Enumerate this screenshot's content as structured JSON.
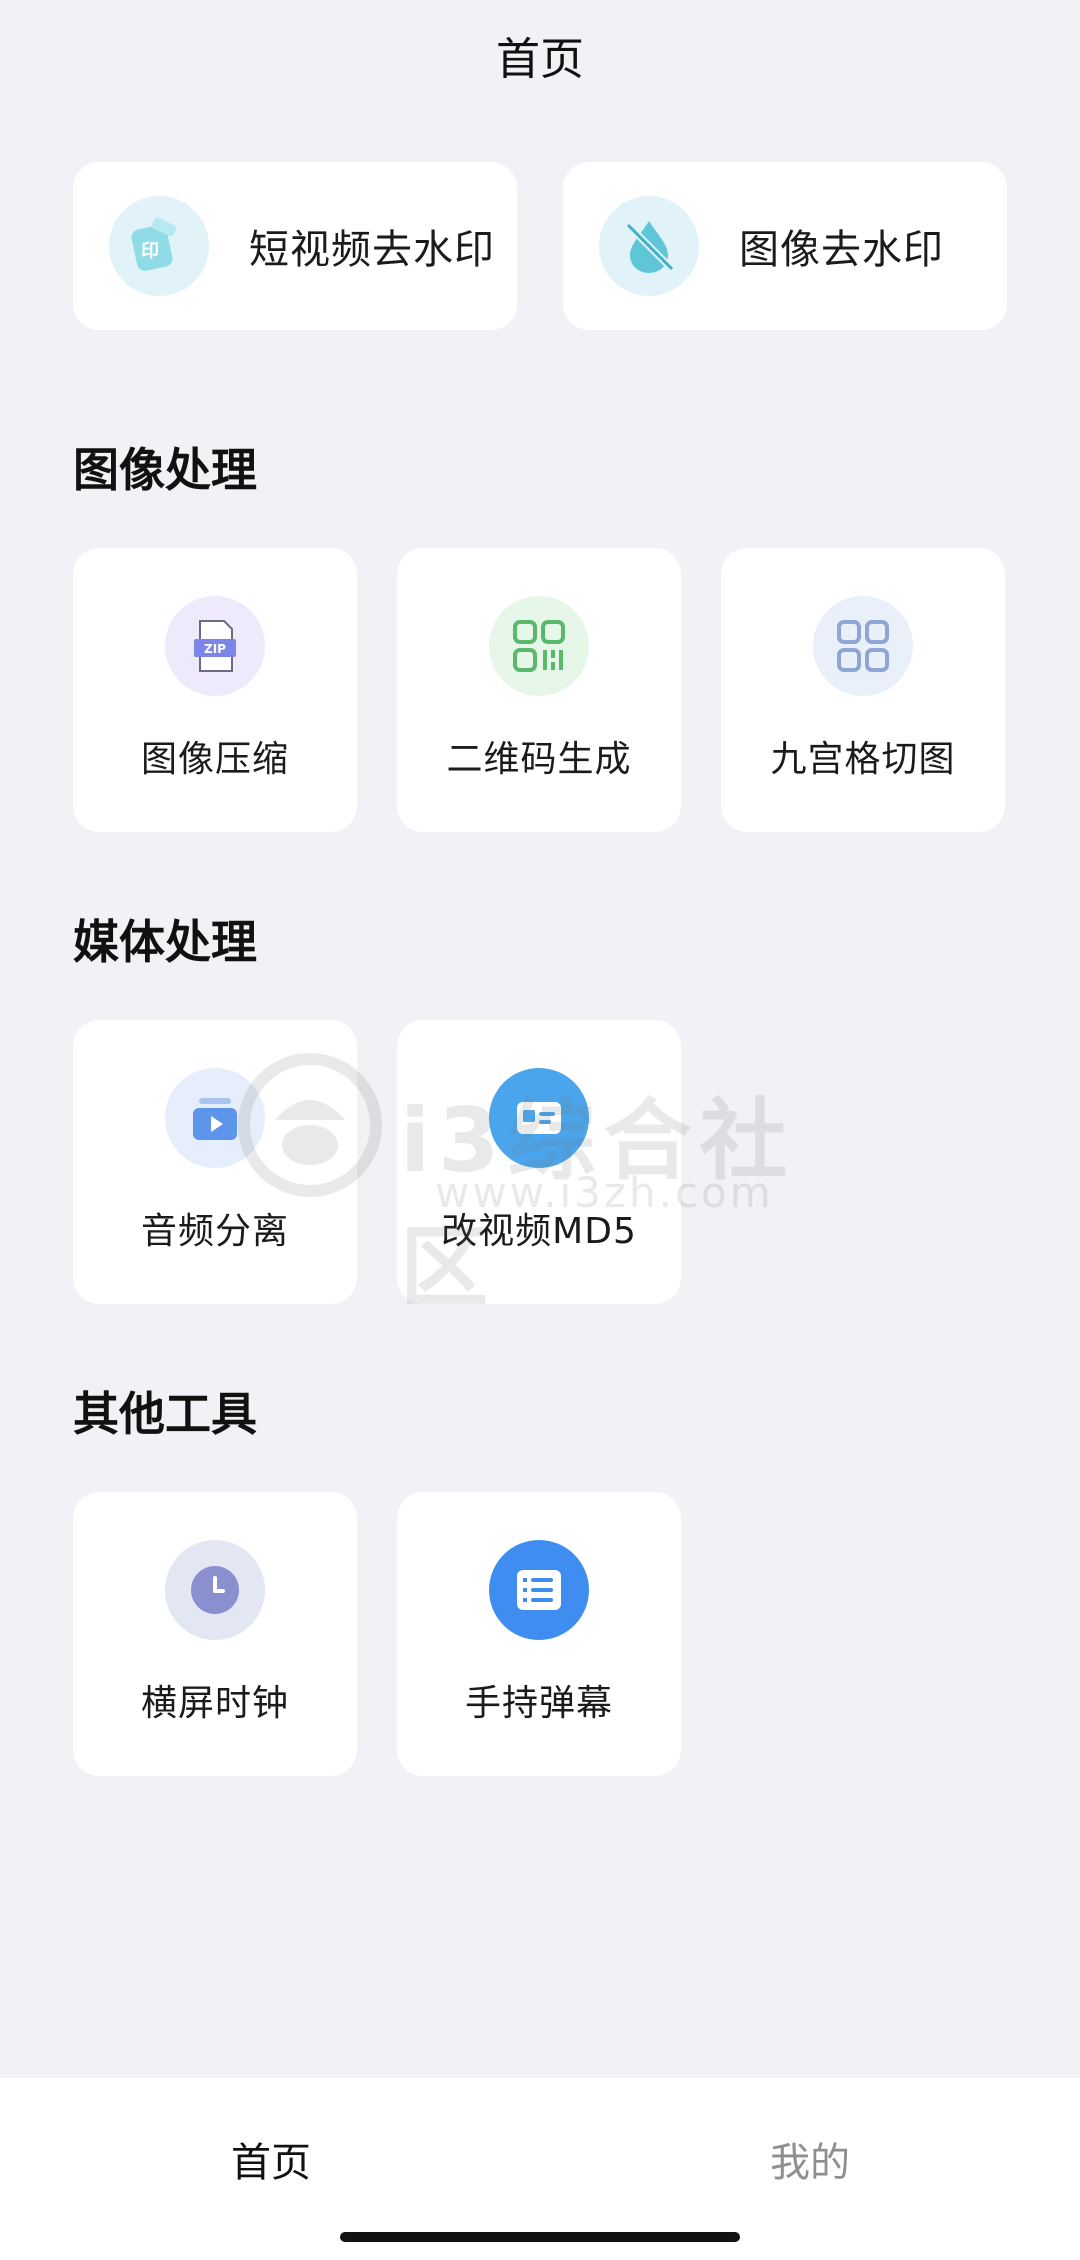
{
  "header": {
    "title": "首页"
  },
  "features": [
    {
      "label": "短视频去水印",
      "icon": "video-watermark-icon",
      "icon_bg": "#e1f3f8"
    },
    {
      "label": "图像去水印",
      "icon": "image-watermark-icon",
      "icon_bg": "#e1f3f8"
    }
  ],
  "sections": {
    "image": {
      "title": "图像处理",
      "items": [
        {
          "label": "图像压缩",
          "icon": "zip-icon",
          "icon_bg": "#efeafb"
        },
        {
          "label": "二维码生成",
          "icon": "qrcode-icon",
          "icon_bg": "#e6f6e8"
        },
        {
          "label": "九宫格切图",
          "icon": "grid-icon",
          "icon_bg": "#eaf0fa"
        }
      ]
    },
    "media": {
      "title": "媒体处理",
      "items": [
        {
          "label": "音频分离",
          "icon": "audio-video-icon",
          "icon_bg": "#e6edfb"
        },
        {
          "label": "改视频MD5",
          "icon": "id-card-icon",
          "icon_bg": "#4aa5ec"
        }
      ]
    },
    "other": {
      "title": "其他工具",
      "items": [
        {
          "label": "横屏时钟",
          "icon": "clock-icon",
          "icon_bg": "#e3e6f3"
        },
        {
          "label": "手持弹幕",
          "icon": "list-icon",
          "icon_bg": "#3f8df0"
        }
      ]
    }
  },
  "watermark": {
    "name": "i3综合社区",
    "url": "www.i3zh.com"
  },
  "bottom_nav": {
    "home": "首页",
    "mine": "我的"
  }
}
